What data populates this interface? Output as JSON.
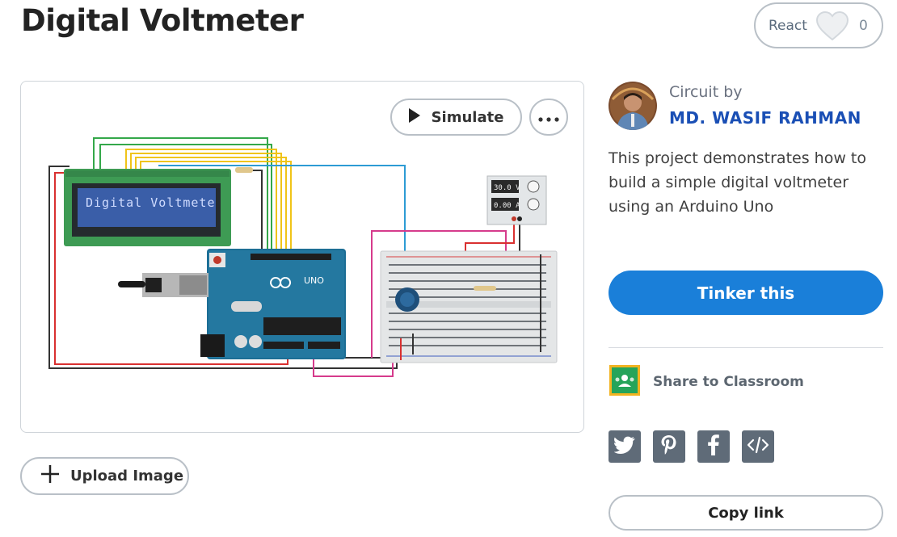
{
  "project": {
    "title": "Digital Voltmeter"
  },
  "react": {
    "label": "React",
    "count": "0"
  },
  "canvas": {
    "simulate_label": "Simulate",
    "lcd_text": "Digital Voltmete",
    "board_label": "UNO",
    "psu": {
      "voltage": "30.0 V",
      "current": "0.00 A"
    }
  },
  "upload": {
    "label": "Upload Image"
  },
  "author": {
    "prefix": "Circuit by",
    "name": "MD. WASIF RAHMAN"
  },
  "description": "This project demonstrates how to build a simple digital voltmeter using an Arduino Uno",
  "tinker": {
    "label": "Tinker this"
  },
  "classroom": {
    "label": "Share to Classroom"
  },
  "socials": [
    {
      "icon": "twitter-icon"
    },
    {
      "icon": "pinterest-icon"
    },
    {
      "icon": "facebook-icon"
    },
    {
      "icon": "embed-code-icon"
    }
  ],
  "copy_link": {
    "label": "Copy link"
  },
  "colors": {
    "accent": "#1a7fd9",
    "author": "#1a4fb5",
    "social_bg": "#5f6b78",
    "classroom_green": "#25a45a",
    "classroom_border": "#f2b320"
  }
}
